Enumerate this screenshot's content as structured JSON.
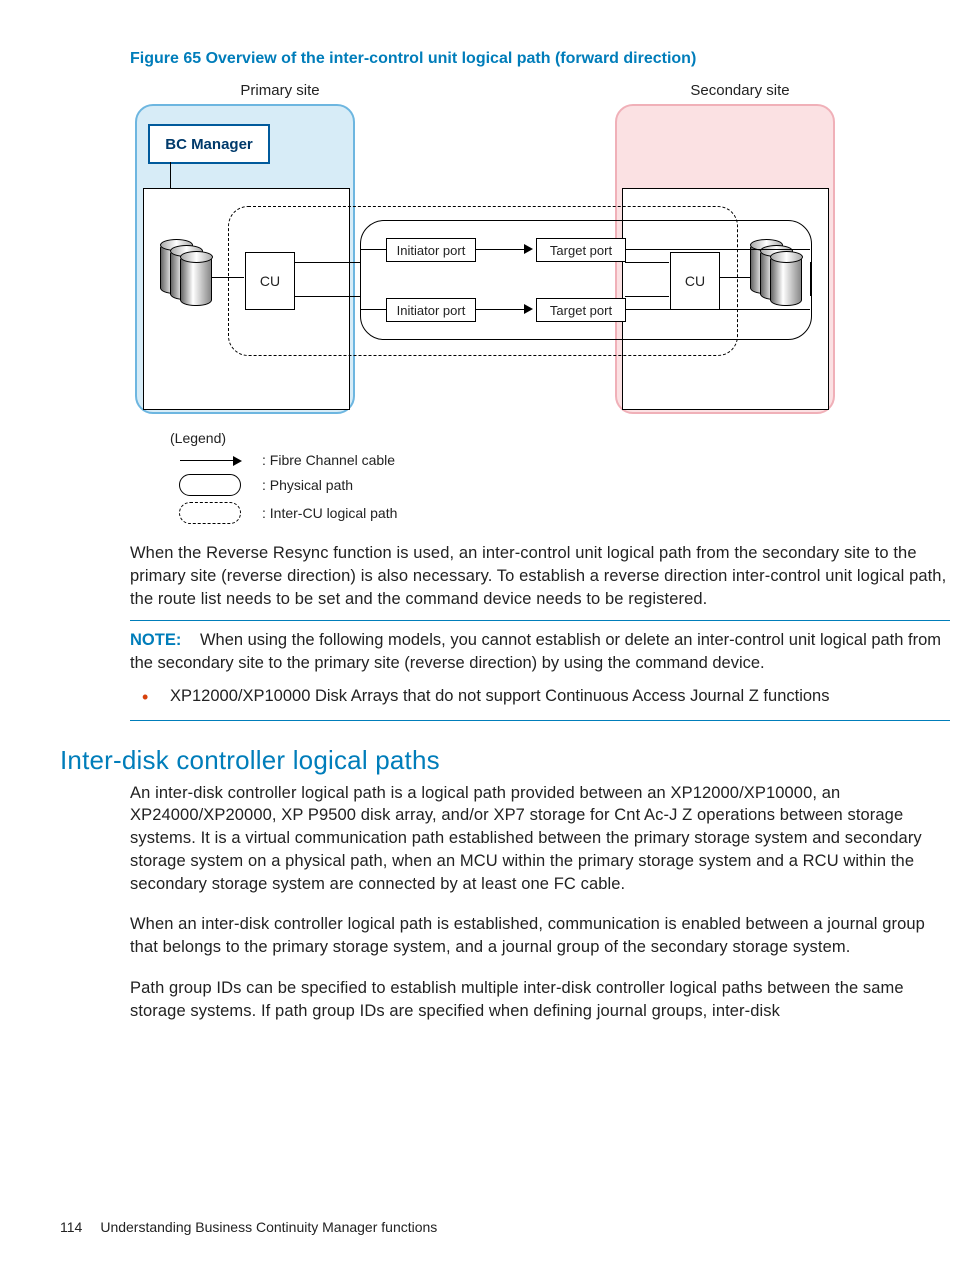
{
  "figure": {
    "caption": "Figure 65 Overview of the inter-control unit logical path (forward direction)",
    "primary_label": "Primary site",
    "secondary_label": "Secondary site",
    "bc_manager": "BC Manager",
    "cu": "CU",
    "initiator_port": "Initiator port",
    "target_port": "Target port",
    "legend_title": "(Legend)",
    "legend_fc": ": Fibre Channel cable",
    "legend_phys": ": Physical path",
    "legend_dash": ": Inter-CU logical path"
  },
  "para1": "When the Reverse Resync function is used, an inter-control unit logical path from the secondary site to the primary site (reverse direction) is also necessary. To establish a reverse direction inter-control unit logical path, the route list needs to be set and the command device needs to be registered.",
  "note": {
    "label": "NOTE:",
    "text": "When using the following models, you cannot establish or delete an inter-control unit logical path from the secondary site to the primary site (reverse direction) by using the command device.",
    "bullet": "XP12000/XP10000 Disk Arrays that do not support Continuous Access Journal Z functions"
  },
  "section_heading": "Inter-disk controller logical paths",
  "para2": "An inter-disk controller logical path is a logical path provided between an XP12000/XP10000, an XP24000/XP20000, XP P9500 disk array, and/or XP7 storage for Cnt Ac-J Z operations between storage systems. It is a virtual communication path established between the primary storage system and secondary storage system on a physical path, when an MCU within the primary storage system and a RCU within the secondary storage system are connected by at least one FC cable.",
  "para3": "When an inter-disk controller logical path is established, communication is enabled between a journal group that belongs to the primary storage system, and a journal group of the secondary storage system.",
  "para4": "Path group IDs can be specified to establish multiple inter-disk controller logical paths between the same storage systems. If path group IDs are specified when defining journal groups, inter-disk",
  "footer": {
    "page": "114",
    "title": "Understanding Business Continuity Manager functions"
  }
}
